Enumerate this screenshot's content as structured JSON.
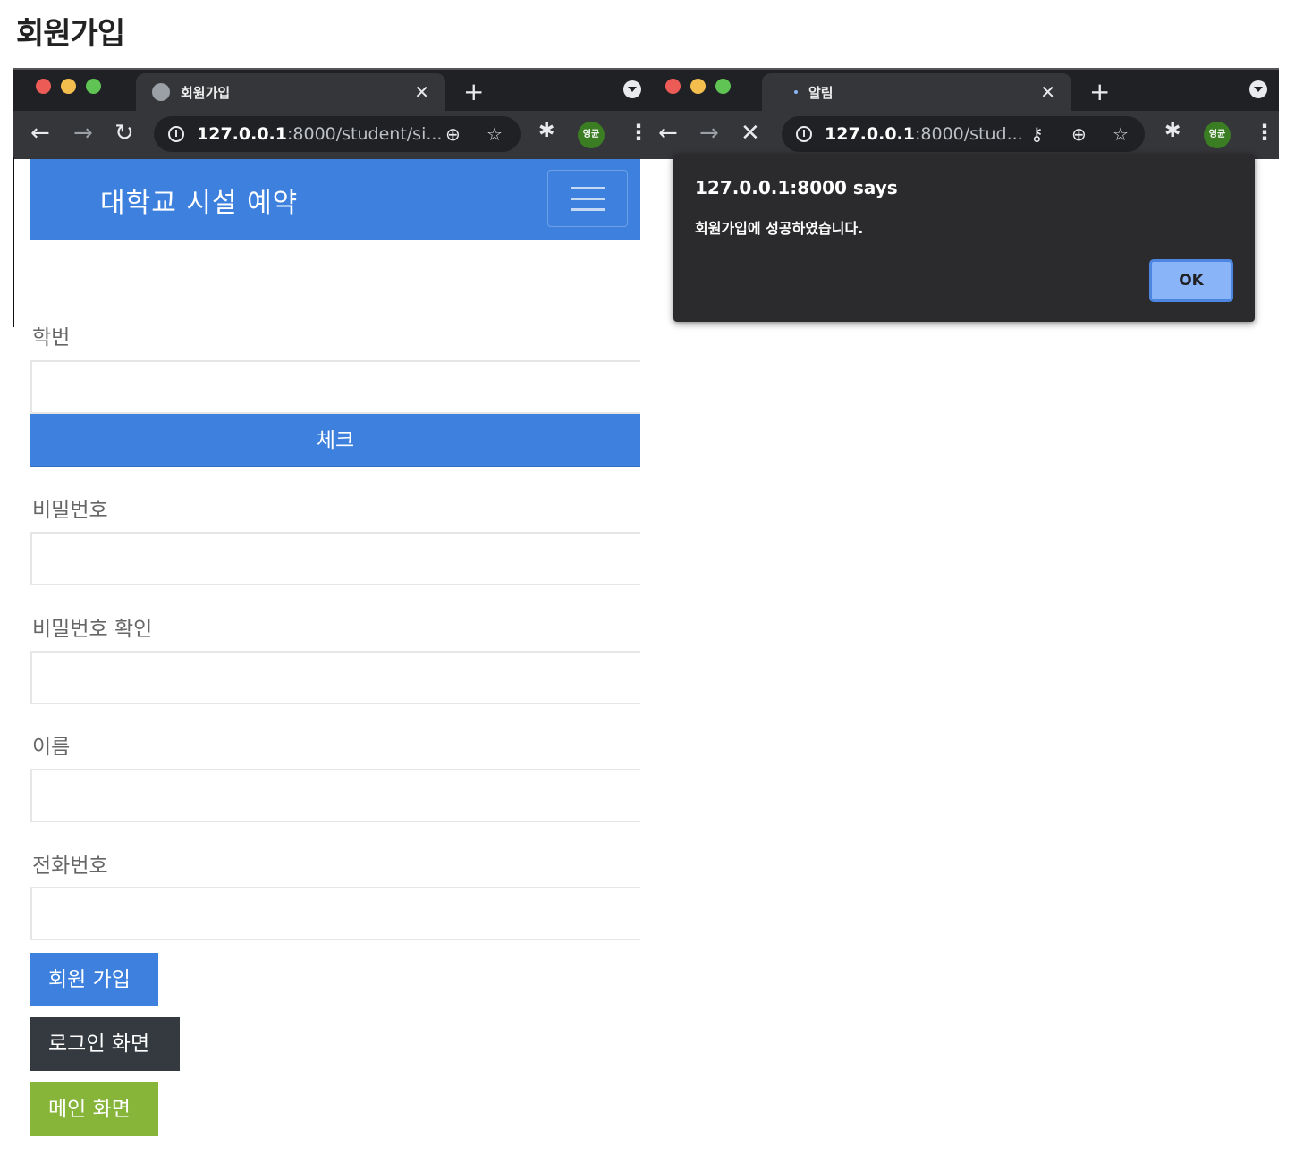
{
  "page": {
    "heading": "회원가입"
  },
  "left_browser": {
    "tab_title": "회원가입",
    "url_host": "127.0.0.1",
    "url_rest": ":8000/student/si...",
    "profile_label": "영균"
  },
  "right_browser": {
    "tab_title": "알림",
    "url_host": "127.0.0.1",
    "url_rest": ":8000/stud...",
    "profile_label": "영균"
  },
  "site": {
    "brand": "대학교 시설 예약",
    "form": {
      "student_id_label": "학번",
      "check_button": "체크",
      "password_label": "비밀번호",
      "password_confirm_label": "비밀번호 확인",
      "name_label": "이름",
      "phone_label": "전화번호",
      "signup_button": "회원 가입",
      "login_button": "로그인 화면",
      "main_button": "메인 화면"
    }
  },
  "alert": {
    "title": "127.0.0.1:8000 says",
    "message": "회원가입에 성공하였습니다.",
    "ok_label": "OK"
  },
  "colors": {
    "primary": "#3d80de",
    "dark": "#343a40",
    "green": "#86b53a",
    "chrome_bg": "#202124"
  }
}
